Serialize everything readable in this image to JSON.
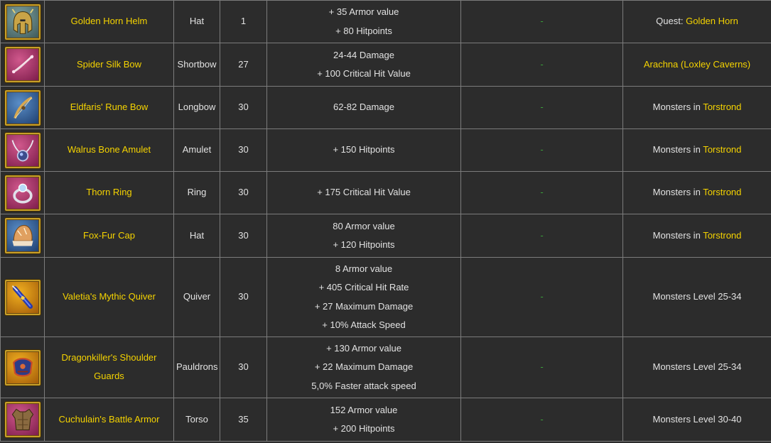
{
  "colors": {
    "background": "#2c2c2c",
    "grid": "#7c7c7c",
    "text": "#e2e2e2",
    "highlight": "#f5d300",
    "dash": "#3a9f3a"
  },
  "rows": [
    {
      "icon": "helm-icon",
      "name": "Golden Horn Helm",
      "type": "Hat",
      "level": "1",
      "stats": [
        "+ 35 Armor value",
        "+ 80 Hitpoints"
      ],
      "set": "-",
      "source_prefix": "Quest: ",
      "source_link": "Golden Horn"
    },
    {
      "icon": "bow-icon",
      "name": "Spider Silk Bow",
      "type": "Shortbow",
      "level": "27",
      "stats": [
        "24-44 Damage",
        "+ 100 Critical Hit Value"
      ],
      "set": "-",
      "source_prefix": "",
      "source_link": "Arachna (Loxley Caverns)"
    },
    {
      "icon": "longbow-icon",
      "name": "Eldfaris' Rune Bow",
      "type": "Longbow",
      "level": "30",
      "stats": [
        "62-82 Damage"
      ],
      "set": "-",
      "source_prefix": "Monsters in ",
      "source_link": "Torstrond"
    },
    {
      "icon": "amulet-icon",
      "name": "Walrus Bone Amulet",
      "type": "Amulet",
      "level": "30",
      "stats": [
        "+ 150 Hitpoints"
      ],
      "set": "-",
      "source_prefix": "Monsters in ",
      "source_link": "Torstrond"
    },
    {
      "icon": "ring-icon",
      "name": "Thorn Ring",
      "type": "Ring",
      "level": "30",
      "stats": [
        "+ 175 Critical Hit Value"
      ],
      "set": "-",
      "source_prefix": "Monsters in ",
      "source_link": "Torstrond"
    },
    {
      "icon": "fur-cap-icon",
      "name": "Fox-Fur Cap",
      "type": "Hat",
      "level": "30",
      "stats": [
        "80 Armor value",
        "+ 120 Hitpoints"
      ],
      "set": "-",
      "source_prefix": "Monsters in ",
      "source_link": "Torstrond"
    },
    {
      "icon": "quiver-icon",
      "name": "Valetia's Mythic Quiver",
      "type": "Quiver",
      "level": "30",
      "stats": [
        "8 Armor value",
        "+ 405 Critical Hit Rate",
        "+ 27 Maximum Damage",
        "+ 10% Attack Speed"
      ],
      "set": "-",
      "source_prefix": "Monsters Level 25-34",
      "source_link": ""
    },
    {
      "icon": "pauldrons-icon",
      "name": "Dragonkiller's Shoulder Guards",
      "type": "Pauldrons",
      "level": "30",
      "stats": [
        "+ 130 Armor value",
        "+ 22 Maximum Damage",
        "5,0% Faster attack speed"
      ],
      "set": "-",
      "source_prefix": "Monsters Level 25-34",
      "source_link": ""
    },
    {
      "icon": "armor-icon",
      "name": "Cuchulain's Battle Armor",
      "type": "Torso",
      "level": "35",
      "stats": [
        "152 Armor value",
        "+ 200 Hitpoints"
      ],
      "set": "-",
      "source_prefix": "Monsters Level 30-40",
      "source_link": ""
    }
  ]
}
